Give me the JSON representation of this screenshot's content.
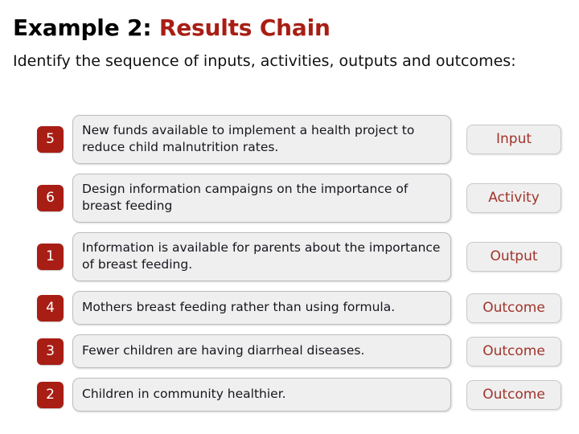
{
  "heading": {
    "title_lead": "Example 2: ",
    "title_accent": "Results Chain",
    "subtitle": "Identify the sequence of inputs, activities, outputs and outcomes:"
  },
  "colors": {
    "accent_red": "#a81e14",
    "tag_text_red": "#a1342b",
    "card_fill": "#efefef",
    "card_border": "#bdbdbd",
    "body_text": "#16161e"
  },
  "rows": [
    {
      "order": "5",
      "statement": "New funds available to implement a health project to reduce child malnutrition rates.",
      "result_type": "Input",
      "lines": 2
    },
    {
      "order": "6",
      "statement": "Design information campaigns on the importance of breast feeding",
      "result_type": "Activity",
      "lines": 2
    },
    {
      "order": "1",
      "statement": "Information is available for parents about the importance of breast feeding.",
      "result_type": "Output",
      "lines": 2
    },
    {
      "order": "4",
      "statement": "Mothers breast feeding rather than using formula.",
      "result_type": "Outcome",
      "lines": 1
    },
    {
      "order": "3",
      "statement": "Fewer children are having diarrheal diseases.",
      "result_type": "Outcome",
      "lines": 1
    },
    {
      "order": "2",
      "statement": "Children in community healthier.",
      "result_type": "Outcome",
      "lines": 1
    }
  ]
}
